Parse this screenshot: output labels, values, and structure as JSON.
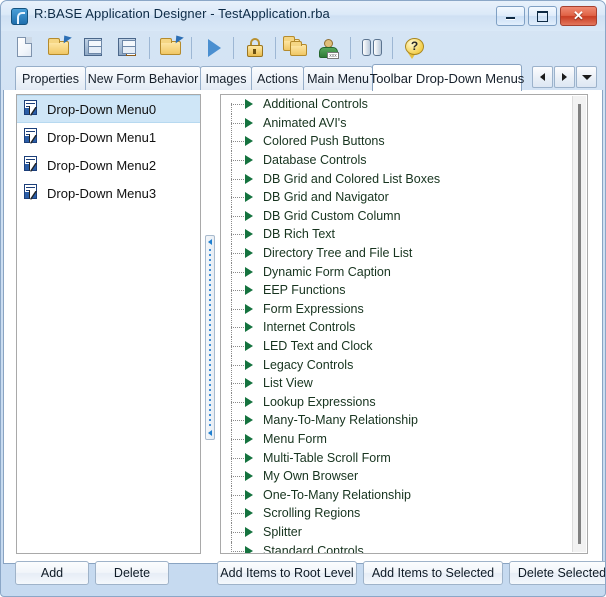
{
  "window": {
    "title": "R:BASE Application Designer - TestApplication.rba",
    "app_icon": "rbase-icon",
    "controls": {
      "minimize": "minimize-button",
      "maximize": "maximize-button",
      "close": "close-button",
      "close_glyph": "✕"
    }
  },
  "toolbar": {
    "items": [
      {
        "name": "new-file-icon",
        "tooltip": "New"
      },
      {
        "name": "open-folder-icon",
        "tooltip": "Open"
      },
      {
        "name": "save-icon",
        "tooltip": "Save"
      },
      {
        "name": "save-as-icon",
        "tooltip": "Save As"
      },
      {
        "name": "open-recent-icon",
        "tooltip": "Open Recent"
      },
      {
        "name": "run-icon",
        "tooltip": "Run"
      },
      {
        "name": "lock-icon",
        "tooltip": "Lock"
      },
      {
        "name": "copy-folder-icon",
        "tooltip": "Copy"
      },
      {
        "name": "user-icon",
        "tooltip": "Users"
      },
      {
        "name": "binoculars-icon",
        "tooltip": "Find"
      },
      {
        "name": "help-icon",
        "tooltip": "Help"
      }
    ]
  },
  "tabs": {
    "items": [
      {
        "label": "Properties",
        "active": false
      },
      {
        "label": "New Form Behavior",
        "active": false
      },
      {
        "label": "Images",
        "active": false
      },
      {
        "label": "Actions",
        "active": false
      },
      {
        "label": "Main Menu",
        "active": false
      },
      {
        "label": "Toolbar Drop-Down Menus",
        "active": true
      }
    ],
    "nav": {
      "prev": "tab-scroll-left",
      "next": "tab-scroll-right",
      "list": "tab-list-dropdown"
    }
  },
  "menu_list": {
    "items": [
      {
        "label": "Drop-Down Menu0",
        "selected": true
      },
      {
        "label": "Drop-Down Menu1",
        "selected": false
      },
      {
        "label": "Drop-Down Menu2",
        "selected": false
      },
      {
        "label": "Drop-Down Menu3",
        "selected": false
      }
    ]
  },
  "tree": {
    "items": [
      "Additional Controls",
      "Animated AVI's",
      "Colored Push Buttons",
      "Database Controls",
      "DB Grid and Colored List Boxes",
      "DB Grid and Navigator",
      "DB Grid Custom Column",
      "DB Rich Text",
      "Directory Tree and File List",
      "Dynamic Form Caption",
      "EEP Functions",
      "Form Expressions",
      "Internet Controls",
      "LED Text and Clock",
      "Legacy Controls",
      "List View",
      "Lookup Expressions",
      "Many-To-Many Relationship",
      "Menu Form",
      "Multi-Table Scroll Form",
      "My Own Browser",
      "One-To-Many Relationship",
      "Scrolling Regions",
      "Splitter",
      "Standard Controls"
    ]
  },
  "buttons": {
    "add": "Add",
    "delete": "Delete",
    "add_items_root": "Add Items to Root Level",
    "add_items_selected": "Add Items to Selected",
    "delete_selected": "Delete Selected"
  },
  "colors": {
    "selection": "#cfe6f7",
    "tree_text": "#17341f",
    "tree_expander": "#15733f",
    "title_text": "#0c2a46",
    "close_button": "#c93c22"
  }
}
